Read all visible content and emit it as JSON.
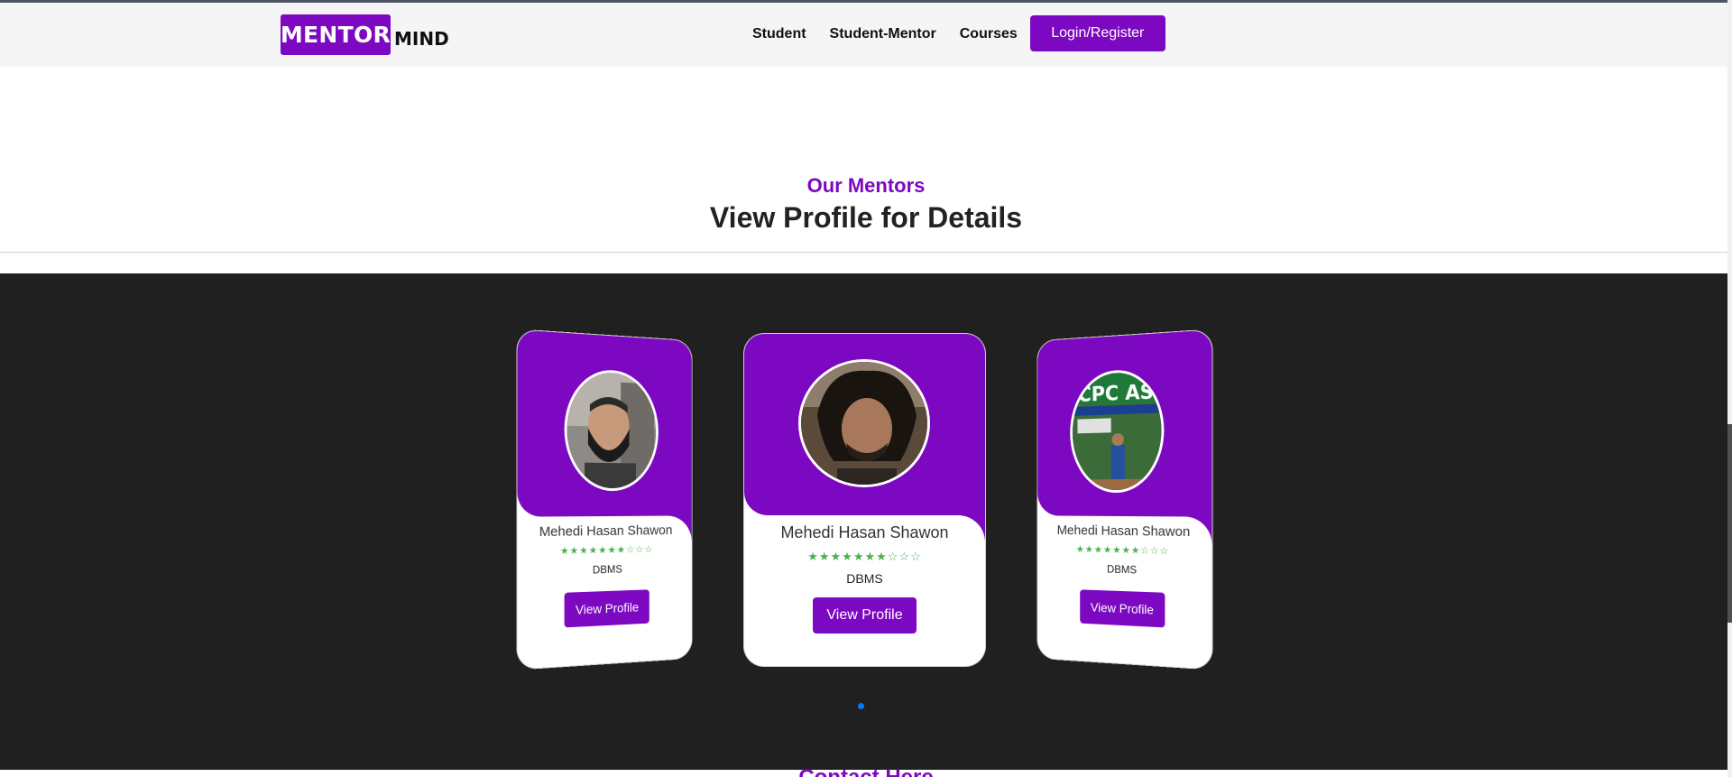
{
  "brand": {
    "logo_box": "MENTOR",
    "logo_rest": "MIND",
    "accent": "#7d08c1"
  },
  "nav": {
    "links": [
      "Student",
      "Student-Mentor",
      "Courses"
    ],
    "login_label": "Login/Register"
  },
  "section": {
    "subtitle": "Our Mentors",
    "title": "View Profile for Details"
  },
  "mentors": [
    {
      "name": "Mehedi Hasan Shawon",
      "stars": "★★★★★★★☆☆☆",
      "subject": "DBMS",
      "button": "View Profile",
      "photo": "bearded man selfie"
    },
    {
      "name": "Mehedi Hasan Shawon",
      "stars": "★★★★★★★☆☆☆",
      "subject": "DBMS",
      "button": "View Profile",
      "photo": "young man portrait"
    },
    {
      "name": "Mehedi Hasan Shawon",
      "stars": "★★★★★★★☆☆☆",
      "subject": "DBMS",
      "button": "View Profile",
      "photo": "ICPC Asia banner photo"
    }
  ],
  "carousel": {
    "active_dot": 1
  },
  "contact": {
    "heading": "Contact Here"
  }
}
